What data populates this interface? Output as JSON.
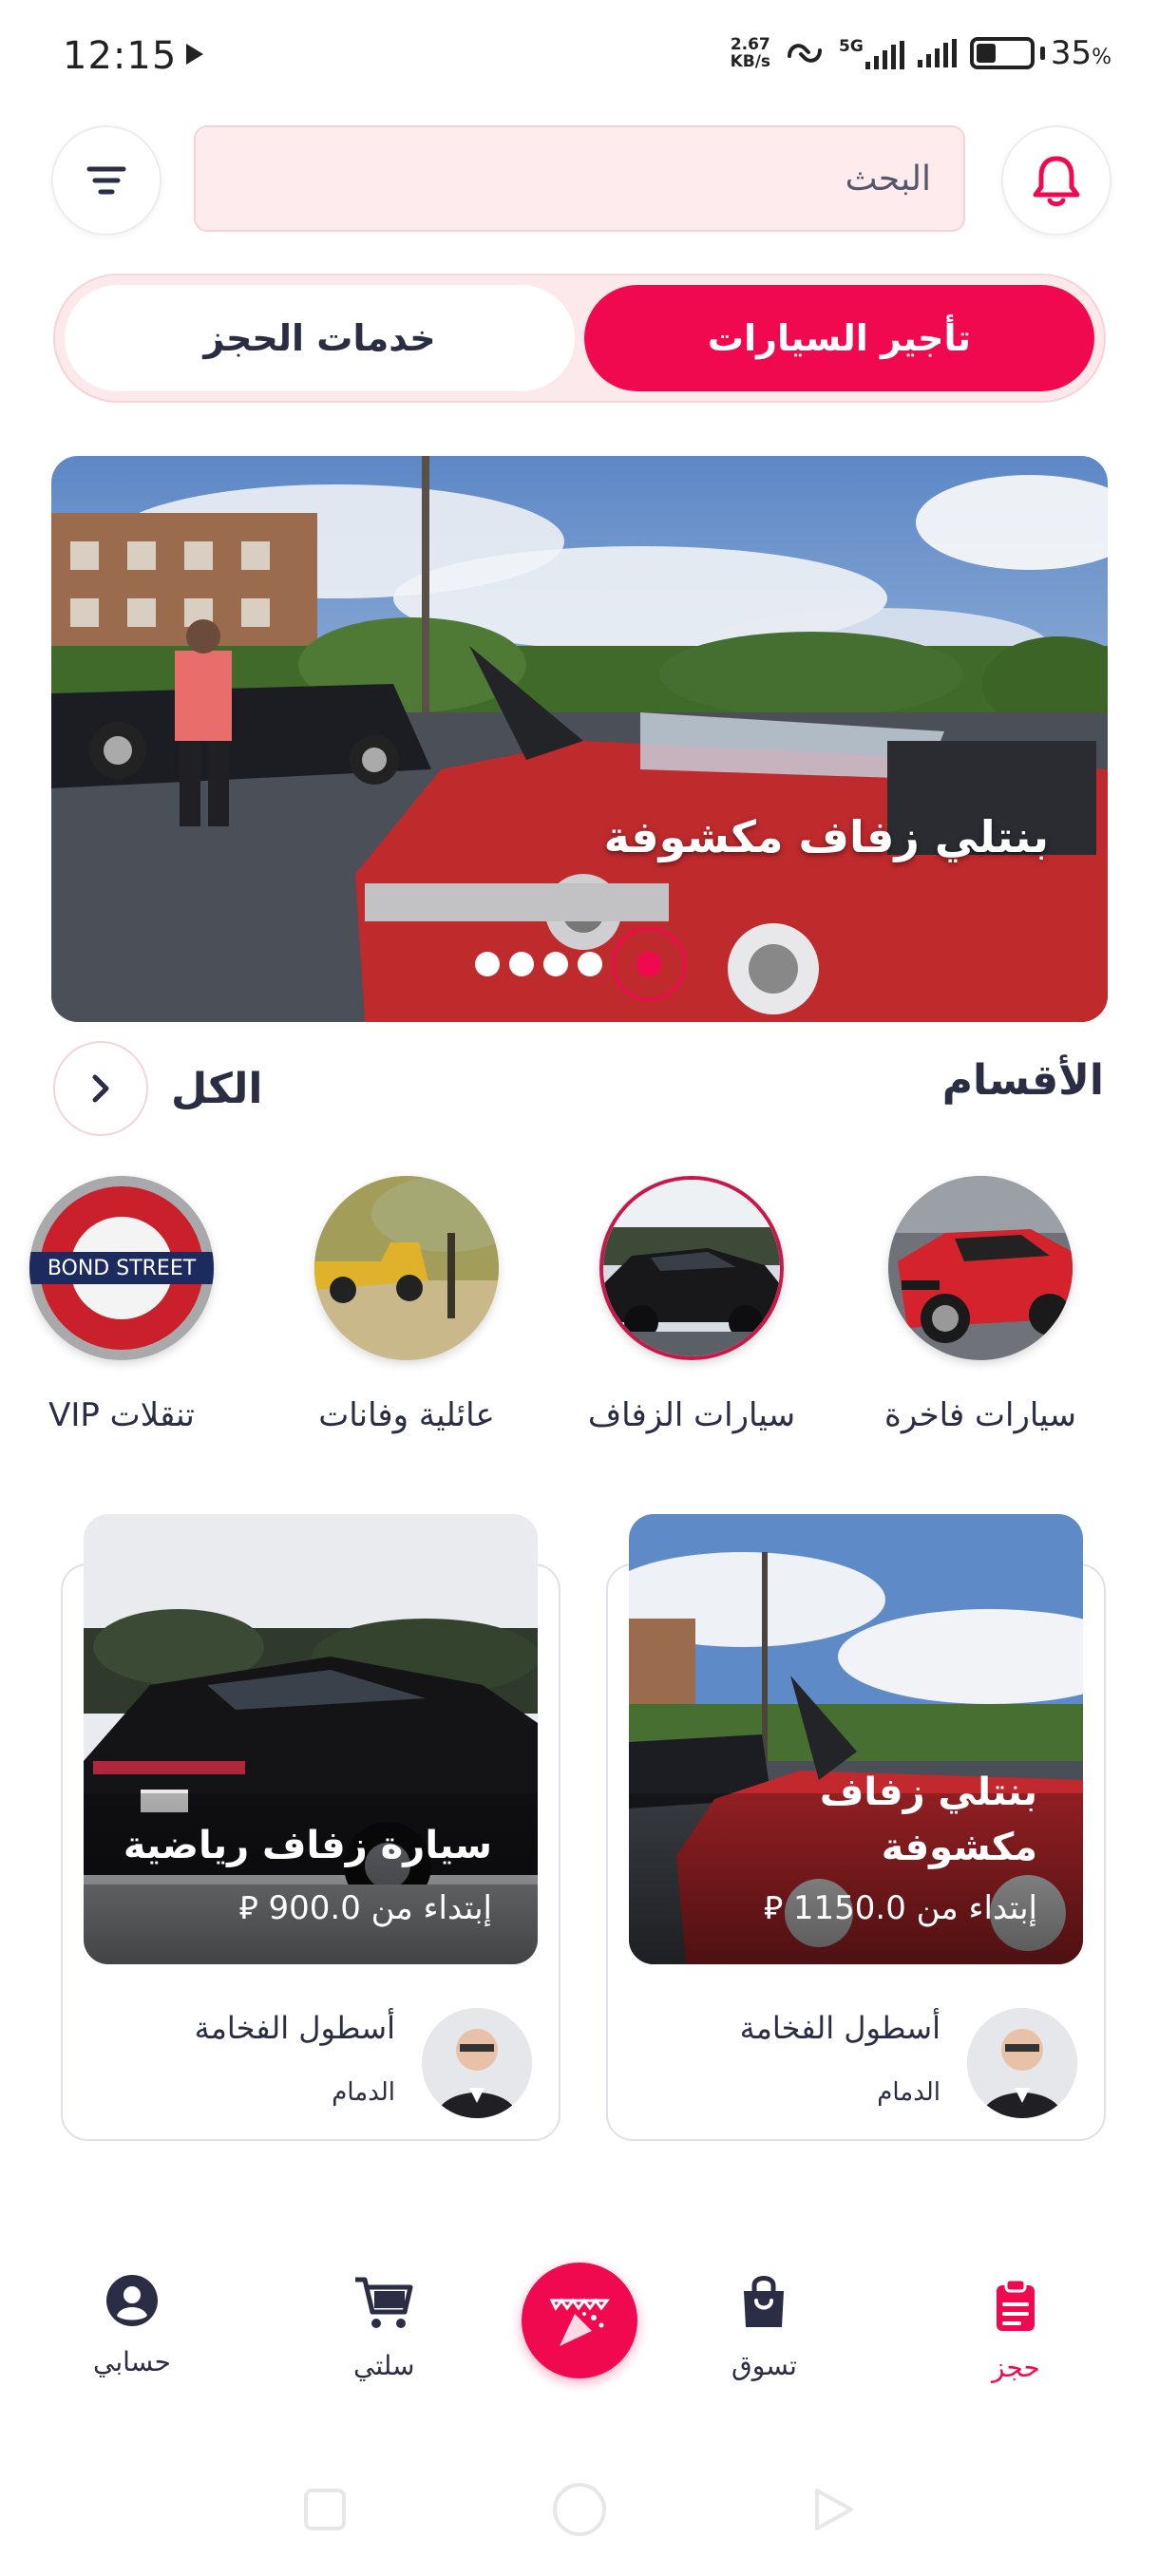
{
  "status_bar": {
    "time": "12:15",
    "net_speed_value": "2.67",
    "net_speed_unit": "KB/s",
    "network_type": "5G",
    "battery_percent": "35",
    "battery_percent_sign": "%"
  },
  "header": {
    "search_placeholder": "البحث"
  },
  "tabs": {
    "active_label": "تأجير السيارات",
    "inactive_label": "خدمات الحجز"
  },
  "hero": {
    "title": "بنتلي زفاف مكشوفة",
    "slides_total": 5,
    "active_slide": 5
  },
  "categories": {
    "title": "الأقسام",
    "see_all_label": "الكل",
    "items": [
      {
        "label": "سيارات فاخرة",
        "icon": "red-sports-car-photo"
      },
      {
        "label": "سيارات الزفاف",
        "icon": "black-sedan-photo"
      },
      {
        "label": "عائلية وفانات",
        "icon": "yellow-pickup-photo"
      },
      {
        "label": "تنقلات VIP",
        "icon": "bond-street-sign-photo"
      }
    ]
  },
  "products": [
    {
      "title": "بنتلي زفاف مكشوفة",
      "price_prefix": "إبتداء من",
      "price": "1150.0",
      "currency_symbol": "⃁",
      "vendor": "أسطول الفخامة",
      "city": "الدمام"
    },
    {
      "title": "سيارة زفاف رياضية",
      "price_prefix": "إبتداء من",
      "price": "900.0",
      "currency_symbol": "⃁",
      "vendor": "أسطول الفخامة",
      "city": "الدمام"
    }
  ],
  "bottom_nav": {
    "items": [
      {
        "label": "حجز",
        "icon": "clipboard-icon",
        "active": true
      },
      {
        "label": "تسوق",
        "icon": "shopping-bag-icon",
        "active": false
      },
      {
        "label": "سلتي",
        "icon": "cart-icon",
        "active": false
      },
      {
        "label": "حسابي",
        "icon": "account-icon",
        "active": false
      }
    ],
    "center_icon": "party-popper-icon"
  },
  "colors": {
    "accent": "#f0094f",
    "text": "#2a2d43",
    "search_bg": "#fdebed"
  }
}
